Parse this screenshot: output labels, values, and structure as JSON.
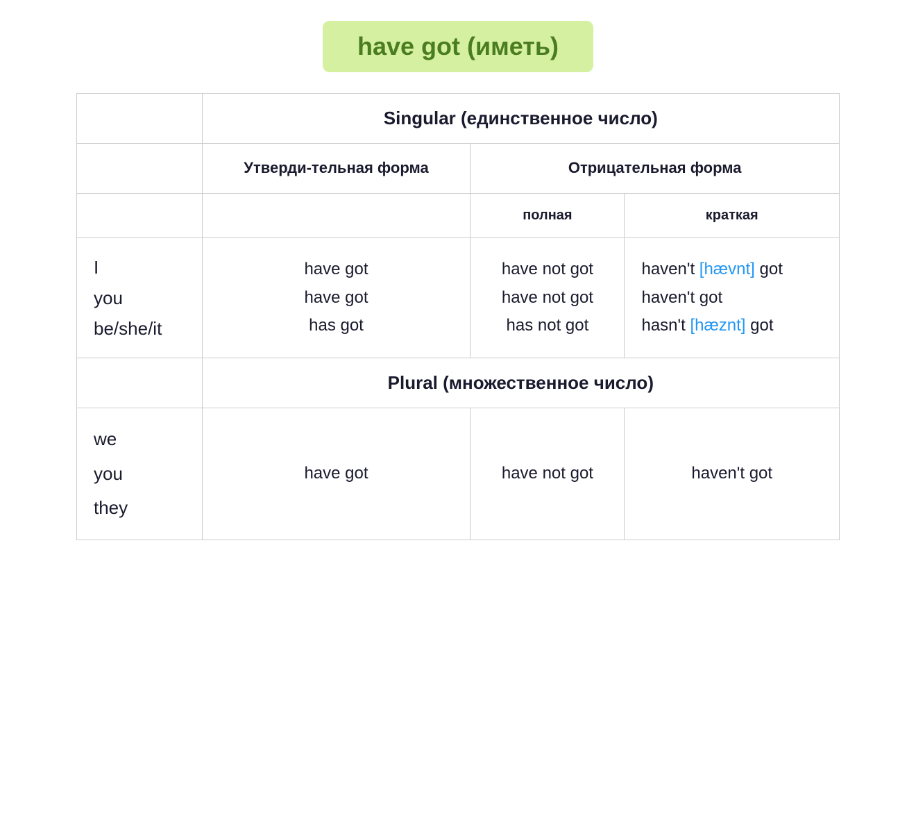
{
  "title": "have got (иметь)",
  "title_bg": "#d4f0a0",
  "title_color": "#4a7c20",
  "singular_label": "Singular (единственное число)",
  "plural_label": "Plural (множественное число)",
  "affirm_label": "Утверди-тельная форма",
  "negative_label": "Отрицательная форма",
  "full_label": "полная",
  "short_label": "краткая",
  "singular_rows": [
    {
      "pronouns": "I\nyou\nbe/she/it",
      "affirm": "have got\nhave got\nhas got",
      "negative_full": "have not got\nhave not got\nhas not got",
      "negative_short_parts": [
        {
          "text": "haven't ",
          "phonetic": "[hævnt]",
          "rest": " got"
        },
        {
          "text": "haven't got",
          "phonetic": null,
          "rest": null
        },
        {
          "text": "hasn't ",
          "phonetic": "[hæznt]",
          "rest": " got"
        }
      ]
    }
  ],
  "plural_rows": [
    {
      "pronouns": "we\nyou\nthey",
      "affirm": "have got",
      "negative_full": "have not got",
      "negative_short": "haven't got"
    }
  ]
}
